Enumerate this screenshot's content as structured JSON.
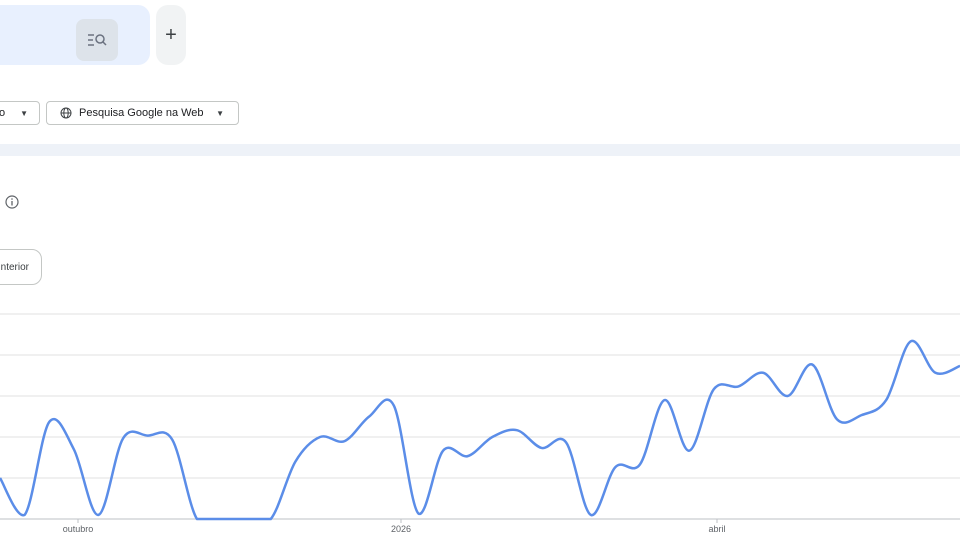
{
  "search": {
    "icon": "search-filter-icon"
  },
  "add_button": {
    "label": "+"
  },
  "filters": {
    "left_chip_label": "o",
    "web_chip_label": "Pesquisa Google na Web",
    "web_chip_icon": "globe-icon"
  },
  "info_icon": "info-icon",
  "previous_button": {
    "label": "nterior"
  },
  "colors": {
    "line": "#5b8de8",
    "grid": "#e0e0e0",
    "accent": "#e8f0fe"
  },
  "chart_data": {
    "type": "line",
    "x_tick_labels": [
      "outubro",
      "2026",
      "abril"
    ],
    "y_gridlines": 5,
    "series": [
      {
        "values": [
          [
            0,
            30
          ],
          [
            2,
            3
          ],
          [
            4,
            71
          ],
          [
            6,
            51
          ],
          [
            8,
            3
          ],
          [
            10,
            59
          ],
          [
            12,
            61
          ],
          [
            14,
            58
          ],
          [
            16,
            0
          ],
          [
            18,
            0
          ],
          [
            20,
            0
          ],
          [
            22,
            0
          ],
          [
            24,
            42
          ],
          [
            26,
            60
          ],
          [
            28,
            57
          ],
          [
            30,
            75
          ],
          [
            32,
            83
          ],
          [
            34,
            4
          ],
          [
            36,
            50
          ],
          [
            38,
            46
          ],
          [
            40,
            60
          ],
          [
            42,
            65
          ],
          [
            44,
            52
          ],
          [
            46,
            56
          ],
          [
            48,
            3
          ],
          [
            50,
            38
          ],
          [
            52,
            40
          ],
          [
            54,
            87
          ],
          [
            56,
            50
          ],
          [
            58,
            95
          ],
          [
            60,
            97
          ],
          [
            62,
            107
          ],
          [
            64,
            90
          ],
          [
            66,
            113
          ],
          [
            68,
            73
          ],
          [
            70,
            76
          ],
          [
            72,
            87
          ],
          [
            74,
            130
          ],
          [
            76,
            107
          ],
          [
            78,
            112
          ]
        ]
      }
    ],
    "xlim": [
      0,
      78
    ],
    "ylim": [
      0,
      150
    ]
  }
}
